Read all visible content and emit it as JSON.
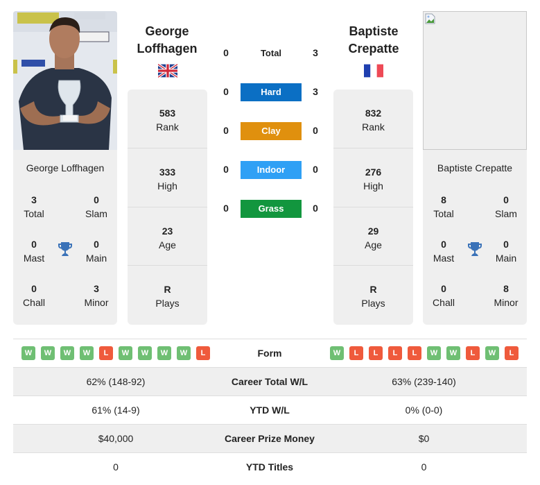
{
  "colors": {
    "hard": "#0b6fc4",
    "clay": "#e0900e",
    "indoor": "#2fa0f5",
    "grass": "#12963e",
    "win": "#6fbf73",
    "loss": "#ef5a3c",
    "trophy": "#3a72b8"
  },
  "player1": {
    "name_line1": "George",
    "name_line2": "Loffhagen",
    "full_name": "George Loffhagen",
    "flag": "uk-flag",
    "photo": "player-photo",
    "stats": [
      {
        "value": "583",
        "label": "Rank"
      },
      {
        "value": "333",
        "label": "High"
      },
      {
        "value": "23",
        "label": "Age"
      },
      {
        "value": "R",
        "label": "Plays"
      }
    ],
    "titles": {
      "total": {
        "value": "3",
        "label": "Total"
      },
      "slam": {
        "value": "0",
        "label": "Slam"
      },
      "mast": {
        "value": "0",
        "label": "Mast"
      },
      "main": {
        "value": "0",
        "label": "Main"
      },
      "chall": {
        "value": "0",
        "label": "Chall"
      },
      "minor": {
        "value": "3",
        "label": "Minor"
      }
    },
    "form": [
      "W",
      "W",
      "W",
      "W",
      "L",
      "W",
      "W",
      "W",
      "W",
      "L"
    ]
  },
  "player2": {
    "name_line1": "Baptiste",
    "name_line2": "Crepatte",
    "full_name": "Baptiste Crepatte",
    "flag": "france-flag",
    "photo": "broken-image",
    "stats": [
      {
        "value": "832",
        "label": "Rank"
      },
      {
        "value": "276",
        "label": "High"
      },
      {
        "value": "29",
        "label": "Age"
      },
      {
        "value": "R",
        "label": "Plays"
      }
    ],
    "titles": {
      "total": {
        "value": "8",
        "label": "Total"
      },
      "slam": {
        "value": "0",
        "label": "Slam"
      },
      "mast": {
        "value": "0",
        "label": "Mast"
      },
      "main": {
        "value": "0",
        "label": "Main"
      },
      "chall": {
        "value": "0",
        "label": "Chall"
      },
      "minor": {
        "value": "8",
        "label": "Minor"
      }
    },
    "form": [
      "W",
      "L",
      "L",
      "L",
      "L",
      "W",
      "W",
      "L",
      "W",
      "L"
    ]
  },
  "h2h": [
    {
      "label": "Total",
      "p1": "0",
      "p2": "3",
      "surface": "total"
    },
    {
      "label": "Hard",
      "p1": "0",
      "p2": "3",
      "surface": "hard"
    },
    {
      "label": "Clay",
      "p1": "0",
      "p2": "0",
      "surface": "clay"
    },
    {
      "label": "Indoor",
      "p1": "0",
      "p2": "0",
      "surface": "indoor"
    },
    {
      "label": "Grass",
      "p1": "0",
      "p2": "0",
      "surface": "grass"
    }
  ],
  "table": {
    "form_label": "Form",
    "rows": [
      {
        "label": "Career Total W/L",
        "p1": "62% (148-92)",
        "p2": "63% (239-140)"
      },
      {
        "label": "YTD W/L",
        "p1": "61% (14-9)",
        "p2": "0% (0-0)"
      },
      {
        "label": "Career Prize Money",
        "p1": "$40,000",
        "p2": "$0"
      },
      {
        "label": "YTD Titles",
        "p1": "0",
        "p2": "0"
      }
    ]
  }
}
